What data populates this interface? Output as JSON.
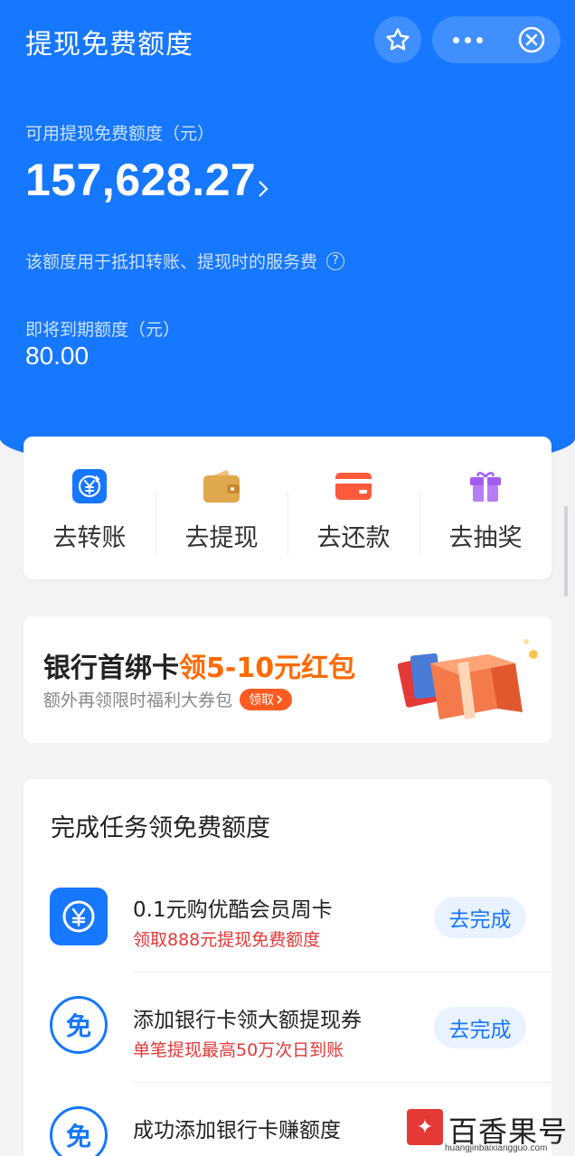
{
  "topbar": {
    "title": "提现免费额度",
    "star_icon": "star-icon",
    "more_icon": "more-dots-icon",
    "close_icon": "close-icon"
  },
  "balance": {
    "label": "可用提现免费额度（元）",
    "amount": "157,628.27",
    "description": "该额度用于抵扣转账、提现时的服务费",
    "expire_label": "即将到期额度（元）",
    "expire_value": "80.00"
  },
  "actions": [
    {
      "label": "去转账",
      "icon": "transfer-yuan-icon",
      "color": "#1677ff"
    },
    {
      "label": "去提现",
      "icon": "wallet-icon",
      "color": "#e0a84c"
    },
    {
      "label": "去还款",
      "icon": "credit-card-icon",
      "color": "#ff5a3c"
    },
    {
      "label": "去抽奖",
      "icon": "gift-icon",
      "color": "#a35cf0"
    }
  ],
  "promo": {
    "title_prefix": "银行首绑卡",
    "title_highlight": "领5-10元红包",
    "subtitle": "额外再领限时福利大券包",
    "button": "领取"
  },
  "tasks": {
    "title": "完成任务领免费额度",
    "items": [
      {
        "name": "0.1元购优酷会员周卡",
        "sub": "领取888元提现免费额度",
        "button": "去完成",
        "icon": "yuan-icon"
      },
      {
        "name": "添加银行卡领大额提现券",
        "sub": "单笔提现最高50万次日到账",
        "button": "去完成",
        "icon": "free-icon",
        "icon_text": "免"
      },
      {
        "name": "成功添加银行卡赚额度",
        "sub": "",
        "button": "",
        "icon": "free-icon",
        "icon_text": "免"
      }
    ]
  },
  "watermark": {
    "text": "百香果号",
    "url": "huangjinbaixiangguo.com"
  },
  "colors": {
    "primary": "#1677ff",
    "accent": "#ff6a00",
    "danger": "#e33838"
  }
}
